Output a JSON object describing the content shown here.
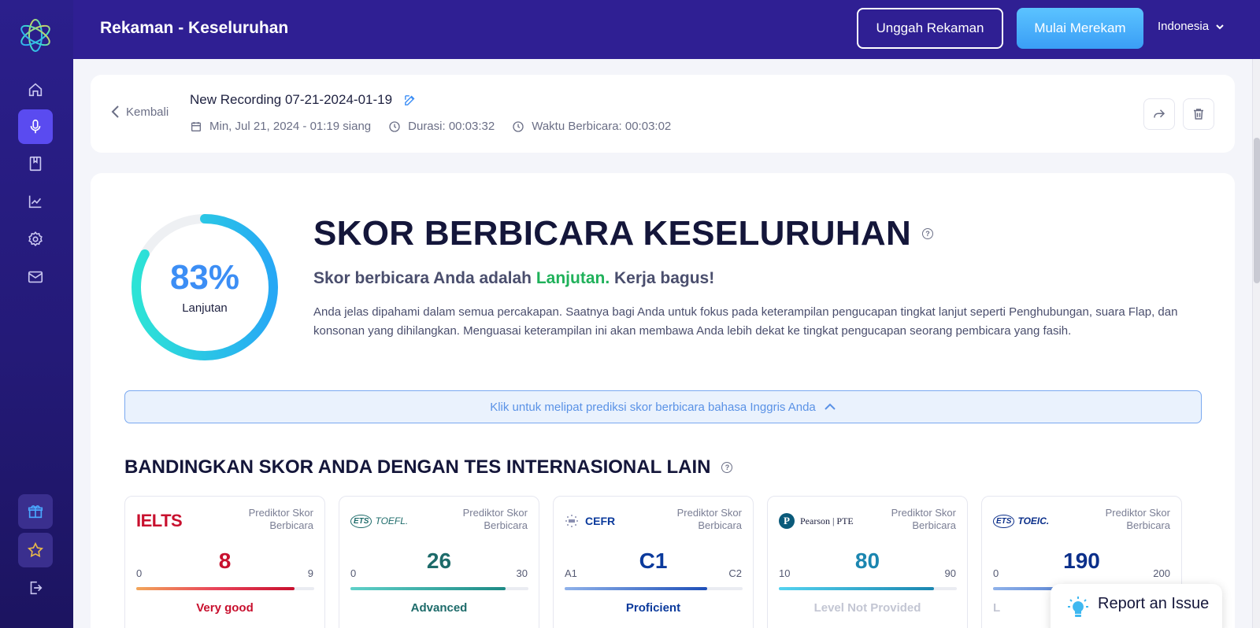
{
  "header": {
    "title": "Rekaman - Keseluruhan",
    "upload_label": "Unggah Rekaman",
    "record_label": "Mulai Merekam",
    "language": "Indonesia"
  },
  "sidebar": {
    "items": [
      {
        "name": "home-icon"
      },
      {
        "name": "microphone-icon",
        "active": true
      },
      {
        "name": "book-icon"
      },
      {
        "name": "chart-icon"
      },
      {
        "name": "gear-icon"
      },
      {
        "name": "mail-icon"
      }
    ],
    "bottom": [
      {
        "name": "gift-icon"
      },
      {
        "name": "star-icon"
      },
      {
        "name": "logout-icon"
      }
    ]
  },
  "recording": {
    "back_label": "Kembali",
    "title": "New Recording 07-21-2024-01-19",
    "date": "Min, Jul 21, 2024 - 01:19 siang",
    "duration": "Durasi: 00:03:32",
    "speaking_time": "Waktu Berbicara: 00:03:02"
  },
  "score": {
    "percent": "83%",
    "percent_value": 0.83,
    "level": "Lanjutan",
    "heading": "SKOR BERBICARA KESELURUHAN",
    "sub_prefix": "Skor berbicara Anda adalah ",
    "sub_level": "Lanjutan.",
    "sub_suffix": " Kerja bagus!",
    "description": "Anda jelas dipahami dalam semua percakapan. Saatnya bagi Anda untuk fokus pada keterampilan pengucapan tingkat lanjut seperti Penghubungan, suara Flap, dan konsonan yang dihilangkan. Menguasai keterampilan ini akan membawa Anda lebih dekat ke tingkat pengucapan seorang pembicara yang fasih.",
    "collapse_label": "Klik untuk melipat prediksi skor berbicara bahasa Inggris Anda"
  },
  "compare": {
    "heading": "BANDINGKAN SKOR ANDA DENGAN TES INTERNASIONAL LAIN",
    "predictor_label": "Prediktor Skor Berbicara",
    "tests": [
      {
        "logo": "IELTS",
        "min": "0",
        "max": "9",
        "score": "8",
        "level": "Very good",
        "fill": 0.89,
        "color": "#c8102e",
        "level_color": "#c8102e",
        "bar": "linear-gradient(90deg,#f2a65a,#e8445a,#c8102e)"
      },
      {
        "logo": "TOEFL.",
        "prefix": "ETS",
        "min": "0",
        "max": "30",
        "score": "26",
        "level": "Advanced",
        "fill": 0.87,
        "color": "#1d6b6a",
        "level_color": "#1d6b6a",
        "bar": "linear-gradient(90deg,#5fd1c9,#1d8a85)"
      },
      {
        "logo": "CEFR",
        "min": "A1",
        "max": "C2",
        "score": "C1",
        "level": "Proficient",
        "fill": 0.8,
        "color": "#0b3a9c",
        "level_color": "#0b3a9c",
        "bar": "linear-gradient(90deg,#8fb2ea,#1e4fb8)"
      },
      {
        "logo": "Pearson | PTE",
        "min": "10",
        "max": "90",
        "score": "80",
        "level": "Level Not Provided",
        "fill": 0.87,
        "color": "#1b86b0",
        "level_color": "#c3c6d3",
        "bar": "linear-gradient(90deg,#54d3f0,#1b86b0)"
      },
      {
        "logo": "TOEIC.",
        "prefix": "ETS",
        "min": "0",
        "max": "200",
        "score": "190",
        "level": "L",
        "fill": 0.9,
        "color": "#0b2f8a",
        "level_color": "#c3c6d3",
        "bar": "linear-gradient(90deg,#8fb2ea,#1e4fb8)"
      }
    ]
  },
  "report": {
    "label": "Report an Issue"
  }
}
